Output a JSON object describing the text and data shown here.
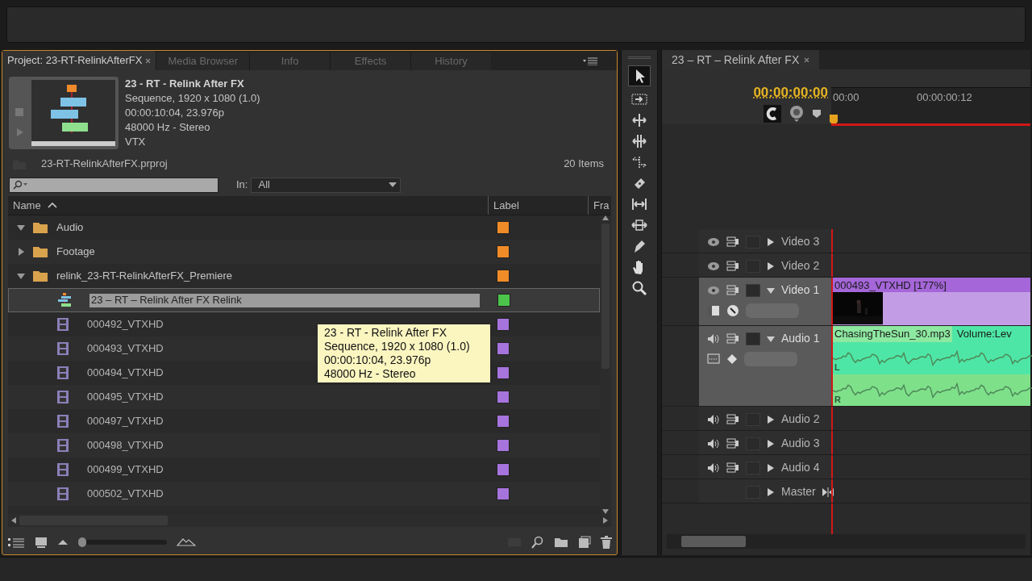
{
  "project_panel": {
    "tabs": [
      {
        "label": "Project: 23-RT-RelinkAfterFX",
        "selected": true
      },
      {
        "label": "Media Browser",
        "selected": false
      },
      {
        "label": "Info",
        "selected": false
      },
      {
        "label": "Effects",
        "selected": false
      },
      {
        "label": "History",
        "selected": false
      }
    ],
    "preview": {
      "title": "23 - RT - Relink After FX",
      "lines": [
        "Sequence, 1920 x 1080 (1.0)",
        "00:00:10:04, 23.976p",
        "48000 Hz - Stereo",
        "VTX"
      ]
    },
    "file_name": "23-RT-RelinkAfterFX.prproj",
    "item_count": "20 Items",
    "in_label": "In:",
    "in_value": "All",
    "columns": [
      "Name",
      "Label",
      "Fra"
    ],
    "items": [
      {
        "kind": "folder",
        "name": "Audio",
        "expanded": true,
        "selected": false,
        "editing": false,
        "color": "#f08c28"
      },
      {
        "kind": "folder",
        "name": "Footage",
        "expanded": false,
        "selected": false,
        "editing": false,
        "color": "#f08c28"
      },
      {
        "kind": "folder",
        "name": "relink_23-RT-RelinkAfterFX_Premiere",
        "expanded": true,
        "selected": false,
        "editing": false,
        "color": "#f08c28",
        "children": [
          {
            "kind": "sequence",
            "name": "23 – RT – Relink After FX Relink",
            "selected": true,
            "editing": true,
            "color": "#4cc44c"
          },
          {
            "kind": "clip",
            "name": "000492_VTXHD",
            "selected": false,
            "editing": false,
            "color": "#a674dc"
          },
          {
            "kind": "clip",
            "name": "000493_VTXHD",
            "selected": false,
            "editing": false,
            "color": "#a674dc"
          },
          {
            "kind": "clip",
            "name": "000494_VTXHD",
            "selected": false,
            "editing": false,
            "color": "#a674dc"
          },
          {
            "kind": "clip",
            "name": "000495_VTXHD",
            "selected": false,
            "editing": false,
            "color": "#a674dc"
          },
          {
            "kind": "clip",
            "name": "000497_VTXHD",
            "selected": false,
            "editing": false,
            "color": "#a674dc"
          },
          {
            "kind": "clip",
            "name": "000498_VTXHD",
            "selected": false,
            "editing": false,
            "color": "#a674dc"
          },
          {
            "kind": "clip",
            "name": "000499_VTXHD",
            "selected": false,
            "editing": false,
            "color": "#a674dc"
          },
          {
            "kind": "clip",
            "name": "000502_VTXHD",
            "selected": false,
            "editing": false,
            "color": "#a674dc"
          }
        ]
      }
    ],
    "zoom_slider": {
      "level": 0
    },
    "tooltip": [
      "23 - RT - Relink After FX",
      "Sequence, 1920 x 1080 (1.0)",
      "00:00:10:04, 23.976p",
      "48000 Hz - Stereo"
    ]
  },
  "tools": [
    {
      "kind": "select",
      "selected": true
    },
    {
      "kind": "track-select",
      "selected": false
    },
    {
      "kind": "ripple",
      "selected": false
    },
    {
      "kind": "rolling",
      "selected": false
    },
    {
      "kind": "rate",
      "selected": false
    },
    {
      "kind": "razor",
      "selected": false
    },
    {
      "kind": "slip",
      "selected": false
    },
    {
      "kind": "slide",
      "selected": false
    },
    {
      "kind": "pen",
      "selected": false
    },
    {
      "kind": "hand",
      "selected": false
    },
    {
      "kind": "zoom",
      "selected": false
    }
  ],
  "timeline": {
    "tab": "23 – RT – Relink After FX",
    "timecode": "00:00:00:00",
    "ruler": [
      "00:00",
      "00:00:00:12"
    ],
    "tracks": [
      {
        "kind": "video",
        "name": "Video 3",
        "expanded": false
      },
      {
        "kind": "video",
        "name": "Video 2",
        "expanded": false
      },
      {
        "kind": "video",
        "name": "Video 1",
        "expanded": true,
        "clip": {
          "title": "000493_VTXHD [177%]"
        }
      },
      {
        "kind": "audio",
        "name": "Audio 1",
        "expanded": true,
        "clip": {
          "title": "ChasingTheSun_30.mp3",
          "effect": "Volume:Lev",
          "channels": [
            "L",
            "R"
          ]
        }
      },
      {
        "kind": "audio",
        "name": "Audio 2",
        "expanded": false
      },
      {
        "kind": "audio",
        "name": "Audio 3",
        "expanded": false
      },
      {
        "kind": "audio",
        "name": "Audio 4",
        "expanded": false
      },
      {
        "kind": "master",
        "name": "Master",
        "expanded": false
      }
    ]
  }
}
